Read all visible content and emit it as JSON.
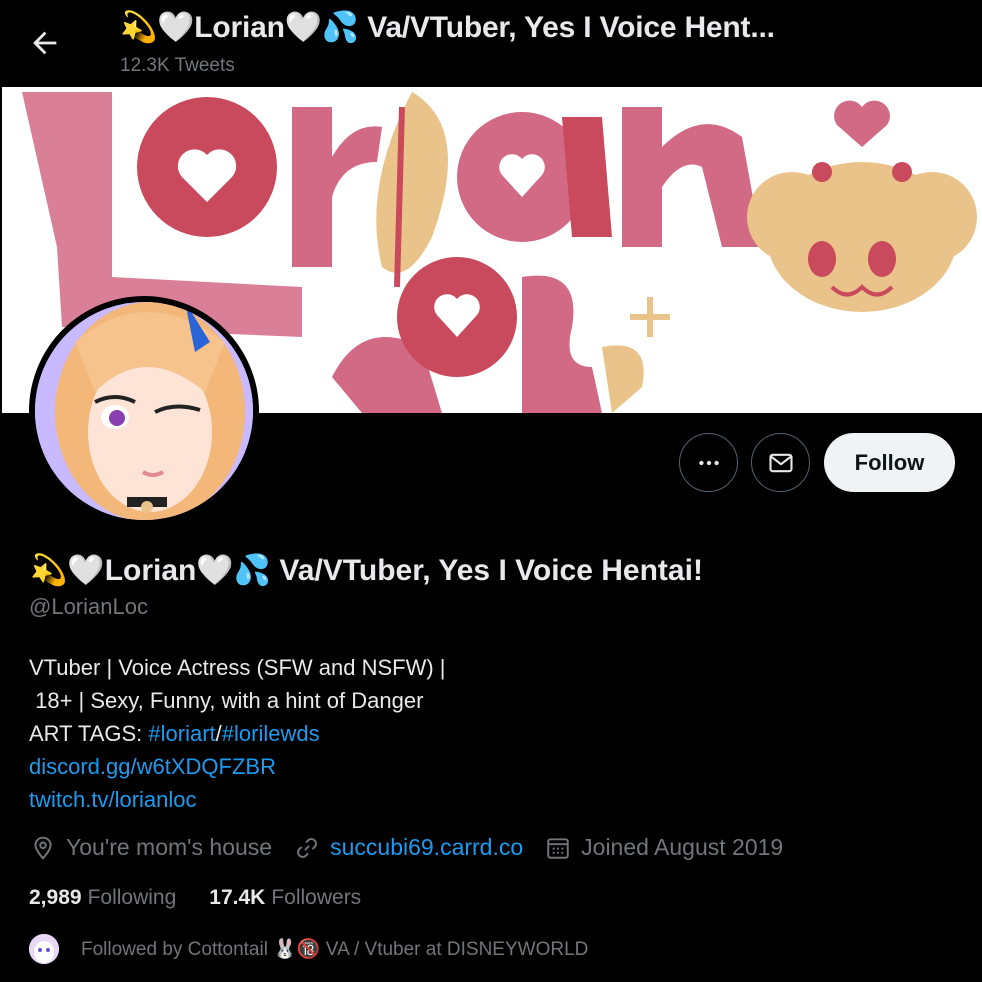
{
  "header": {
    "title": "💫🤍Lorian🤍💦 Va/VTuber, Yes I Voice Hent...",
    "subtitle": "12.3K Tweets"
  },
  "banner": {
    "text_line1": "Lorian",
    "text_line2": "Loc"
  },
  "actions": {
    "follow_label": "Follow"
  },
  "profile": {
    "display_name": "💫🤍Lorian🤍💦 Va/VTuber, Yes I Voice Hentai!",
    "handle": "@LorianLoc",
    "bio_line1": "VTuber | Voice Actress (SFW and NSFW) |",
    "bio_line2": " 18+ | Sexy, Funny, with a hint of Danger",
    "bio_line3_prefix": "ART TAGS: ",
    "bio_tag1": "#loriart",
    "bio_sep": "/",
    "bio_tag2": "#lorilewds",
    "bio_link1": "discord.gg/w6tXDQFZBR",
    "bio_link2": "twitch.tv/lorianloc",
    "location": "You're mom's house",
    "website": "succubi69.carrd.co",
    "joined": "Joined August 2019",
    "following_count": "2,989",
    "following_label": "Following",
    "followers_count": "17.4K",
    "followers_label": "Followers",
    "followed_by": "Followed by Cottontail 🐰🔞 VA / Vtuber at DISNEYWORLD"
  },
  "colors": {
    "link": "#1d9bf0",
    "muted": "#71767b",
    "banner_pink": "#d26a86",
    "banner_red": "#c84a5c",
    "banner_tan": "#eac38a"
  }
}
